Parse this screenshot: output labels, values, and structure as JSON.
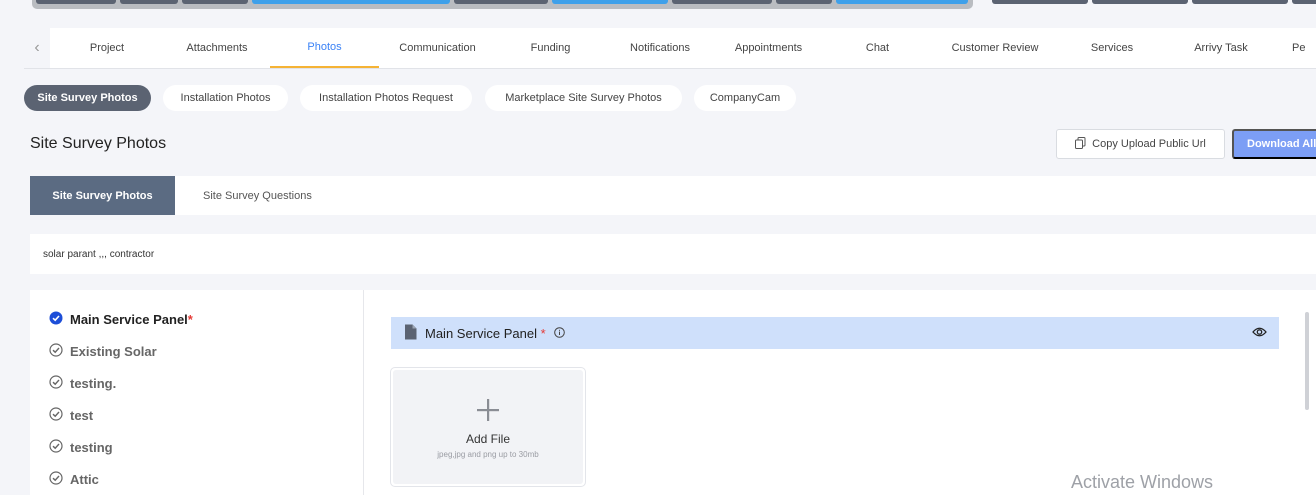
{
  "stepper": {
    "segment_colors": [
      "#5b6372",
      "#5b6372",
      "#5b6372",
      "#3ea0ea",
      "#5b6372",
      "#3ea0ea",
      "#5b6372",
      "#5b6372",
      "#3ea0ea",
      "#5b6372",
      "#5b6372",
      "#5b6372",
      "#5b6372"
    ]
  },
  "tabs": {
    "prev_icon": "chevron-left-icon",
    "items": [
      {
        "label": "Project"
      },
      {
        "label": "Attachments"
      },
      {
        "label": "Photos",
        "active": true
      },
      {
        "label": "Communication"
      },
      {
        "label": "Funding"
      },
      {
        "label": "Notifications"
      },
      {
        "label": "Appointments"
      },
      {
        "label": "Chat"
      },
      {
        "label": "Customer Review"
      },
      {
        "label": "Services"
      },
      {
        "label": "Arrivy Task"
      },
      {
        "label": "Pe"
      }
    ]
  },
  "photo_categories": [
    {
      "label": "Site Survey Photos",
      "active": true
    },
    {
      "label": "Installation Photos"
    },
    {
      "label": "Installation Photos Request"
    },
    {
      "label": "Marketplace Site Survey Photos"
    },
    {
      "label": "CompanyCam"
    }
  ],
  "section_title": "Site Survey Photos",
  "actions": {
    "copy_label": "Copy Upload Public Url",
    "download_label": "Download All"
  },
  "subtabs": {
    "photos": "Site Survey Photos",
    "questions": "Site Survey Questions"
  },
  "info_text": "solar parant ,,, contractor",
  "checklist": [
    {
      "label": "Main Service Panel",
      "required": "*",
      "active": true
    },
    {
      "label": "Existing Solar"
    },
    {
      "label": "testing."
    },
    {
      "label": "test"
    },
    {
      "label": "testing"
    },
    {
      "label": "Attic"
    }
  ],
  "upload_section": {
    "title": "Main Service Panel",
    "required": "*",
    "add_label": "Add File",
    "hint": "jpeg,jpg and png up to 30mb"
  },
  "colors": {
    "accent_blue": "#3b82f6",
    "active_tab_underline": "#f5b335",
    "pill_active": "#5b6372",
    "header_blue": "#cfe0fb",
    "download_button": "#7c9ef5",
    "check_active": "#1d4ed8"
  },
  "watermark": "Activate Windows"
}
